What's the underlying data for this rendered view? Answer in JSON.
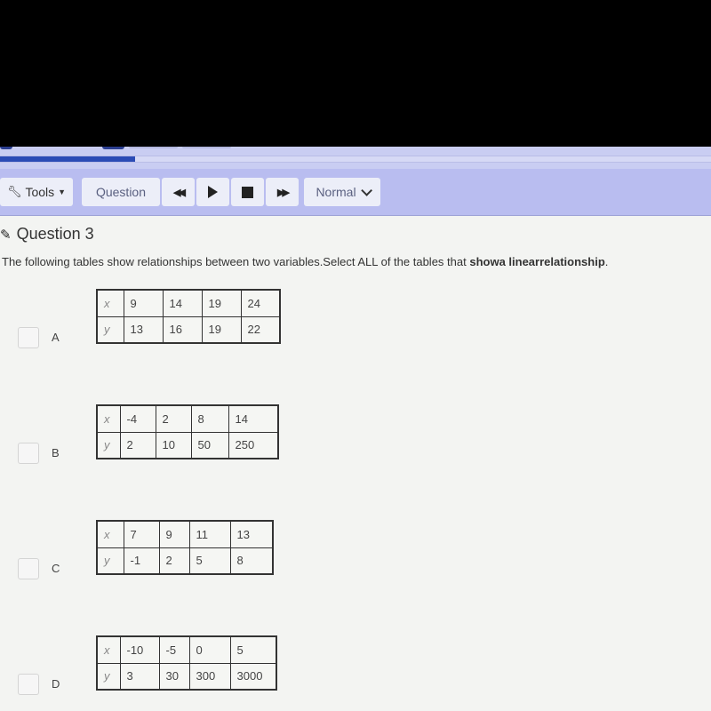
{
  "toolbar": {
    "tools_label": "Tools",
    "question_label": "Question",
    "rewind_icon": "rewind-icon",
    "play_icon": "play-icon",
    "stop_icon": "stop-icon",
    "fast_forward_icon": "fast-forward-icon",
    "speed_label": "Normal"
  },
  "progress": {
    "percent": 19
  },
  "question": {
    "title": "Question 3",
    "prompt_before": "The following tables show relationships between two variables.Select  ALL of  the tables that ",
    "prompt_bold": "showa linearrelationship",
    "prompt_after": "."
  },
  "choices": [
    {
      "letter": "A",
      "checked": false,
      "x": [
        "9",
        "14",
        "19",
        "24"
      ],
      "y": [
        "13",
        "16",
        "19",
        "22"
      ]
    },
    {
      "letter": "B",
      "checked": false,
      "x": [
        "-4",
        "2",
        "8",
        "14"
      ],
      "y": [
        "2",
        "10",
        "50",
        "250"
      ]
    },
    {
      "letter": "C",
      "checked": false,
      "x": [
        "7",
        "9",
        "11",
        "13"
      ],
      "y": [
        "-1",
        "2",
        "5",
        "8"
      ]
    },
    {
      "letter": "D",
      "checked": false,
      "x": [
        "-10",
        "-5",
        "0",
        "5"
      ],
      "y": [
        "3",
        "30",
        "300",
        "3000"
      ]
    }
  ],
  "table_labels": {
    "x": "x",
    "y": "y"
  }
}
